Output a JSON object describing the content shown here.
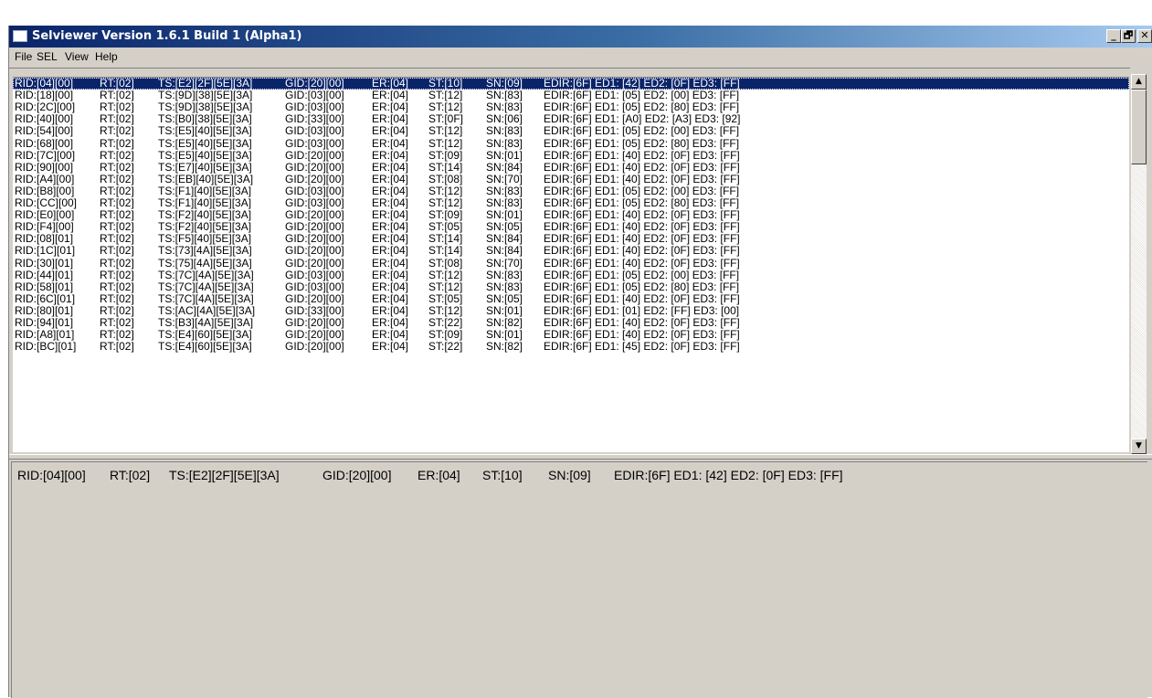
{
  "window": {
    "title": "Selviewer Version 1.6.1 Build 1 (Alpha1)",
    "controls": {
      "minimize": "_",
      "restore": "🗗",
      "close": "✕"
    }
  },
  "menu": [
    "File",
    "SEL",
    "View",
    "Help"
  ],
  "scrollbar": {
    "up": "▲",
    "down": "▼"
  },
  "columns": [
    "rid",
    "rt",
    "ts",
    "gid",
    "er",
    "st",
    "sn",
    "edir"
  ],
  "rows": [
    {
      "rid": "RID:[04][00]",
      "rt": "RT:[02]",
      "ts": "TS:[E2][2F][5E][3A]",
      "gid": "GID:[20][00]",
      "er": "ER:[04]",
      "st": "ST:[10]",
      "sn": "SN:[09]",
      "edir": "EDIR:[6F] ED1: [42] ED2: [0F] ED3: [FF]"
    },
    {
      "rid": "RID:[18][00]",
      "rt": "RT:[02]",
      "ts": "TS:[9D][38][5E][3A]",
      "gid": "GID:[03][00]",
      "er": "ER:[04]",
      "st": "ST:[12]",
      "sn": "SN:[83]",
      "edir": "EDIR:[6F] ED1: [05] ED2: [00] ED3: [FF]"
    },
    {
      "rid": "RID:[2C][00]",
      "rt": "RT:[02]",
      "ts": "TS:[9D][38][5E][3A]",
      "gid": "GID:[03][00]",
      "er": "ER:[04]",
      "st": "ST:[12]",
      "sn": "SN:[83]",
      "edir": "EDIR:[6F] ED1: [05] ED2: [80] ED3: [FF]"
    },
    {
      "rid": "RID:[40][00]",
      "rt": "RT:[02]",
      "ts": "TS:[B0][38][5E][3A]",
      "gid": "GID:[33][00]",
      "er": "ER:[04]",
      "st": "ST:[0F]",
      "sn": "SN:[06]",
      "edir": "EDIR:[6F] ED1: [A0] ED2: [A3] ED3: [92]"
    },
    {
      "rid": "RID:[54][00]",
      "rt": "RT:[02]",
      "ts": "TS:[E5][40][5E][3A]",
      "gid": "GID:[03][00]",
      "er": "ER:[04]",
      "st": "ST:[12]",
      "sn": "SN:[83]",
      "edir": "EDIR:[6F] ED1: [05] ED2: [00] ED3: [FF]"
    },
    {
      "rid": "RID:[68][00]",
      "rt": "RT:[02]",
      "ts": "TS:[E5][40][5E][3A]",
      "gid": "GID:[03][00]",
      "er": "ER:[04]",
      "st": "ST:[12]",
      "sn": "SN:[83]",
      "edir": "EDIR:[6F] ED1: [05] ED2: [80] ED3: [FF]"
    },
    {
      "rid": "RID:[7C][00]",
      "rt": "RT:[02]",
      "ts": "TS:[E5][40][5E][3A]",
      "gid": "GID:[20][00]",
      "er": "ER:[04]",
      "st": "ST:[09]",
      "sn": "SN:[01]",
      "edir": "EDIR:[6F] ED1: [40] ED2: [0F] ED3: [FF]"
    },
    {
      "rid": "RID:[90][00]",
      "rt": "RT:[02]",
      "ts": "TS:[E7][40][5E][3A]",
      "gid": "GID:[20][00]",
      "er": "ER:[04]",
      "st": "ST:[14]",
      "sn": "SN:[84]",
      "edir": "EDIR:[6F] ED1: [40] ED2: [0F] ED3: [FF]"
    },
    {
      "rid": "RID:[A4][00]",
      "rt": "RT:[02]",
      "ts": "TS:[EB][40][5E][3A]",
      "gid": "GID:[20][00]",
      "er": "ER:[04]",
      "st": "ST:[08]",
      "sn": "SN:[70]",
      "edir": "EDIR:[6F] ED1: [40] ED2: [0F] ED3: [FF]"
    },
    {
      "rid": "RID:[B8][00]",
      "rt": "RT:[02]",
      "ts": "TS:[F1][40][5E][3A]",
      "gid": "GID:[03][00]",
      "er": "ER:[04]",
      "st": "ST:[12]",
      "sn": "SN:[83]",
      "edir": "EDIR:[6F] ED1: [05] ED2: [00] ED3: [FF]"
    },
    {
      "rid": "RID:[CC][00]",
      "rt": "RT:[02]",
      "ts": "TS:[F1][40][5E][3A]",
      "gid": "GID:[03][00]",
      "er": "ER:[04]",
      "st": "ST:[12]",
      "sn": "SN:[83]",
      "edir": "EDIR:[6F] ED1: [05] ED2: [80] ED3: [FF]"
    },
    {
      "rid": "RID:[E0][00]",
      "rt": "RT:[02]",
      "ts": "TS:[F2][40][5E][3A]",
      "gid": "GID:[20][00]",
      "er": "ER:[04]",
      "st": "ST:[09]",
      "sn": "SN:[01]",
      "edir": "EDIR:[6F] ED1: [40] ED2: [0F] ED3: [FF]"
    },
    {
      "rid": "RID:[F4][00]",
      "rt": "RT:[02]",
      "ts": "TS:[F2][40][5E][3A]",
      "gid": "GID:[20][00]",
      "er": "ER:[04]",
      "st": "ST:[05]",
      "sn": "SN:[05]",
      "edir": "EDIR:[6F] ED1: [40] ED2: [0F] ED3: [FF]"
    },
    {
      "rid": "RID:[08][01]",
      "rt": "RT:[02]",
      "ts": "TS:[F5][40][5E][3A]",
      "gid": "GID:[20][00]",
      "er": "ER:[04]",
      "st": "ST:[14]",
      "sn": "SN:[84]",
      "edir": "EDIR:[6F] ED1: [40] ED2: [0F] ED3: [FF]"
    },
    {
      "rid": "RID:[1C][01]",
      "rt": "RT:[02]",
      "ts": "TS:[73][4A][5E][3A]",
      "gid": "GID:[20][00]",
      "er": "ER:[04]",
      "st": "ST:[14]",
      "sn": "SN:[84]",
      "edir": "EDIR:[6F] ED1: [40] ED2: [0F] ED3: [FF]"
    },
    {
      "rid": "RID:[30][01]",
      "rt": "RT:[02]",
      "ts": "TS:[75][4A][5E][3A]",
      "gid": "GID:[20][00]",
      "er": "ER:[04]",
      "st": "ST:[08]",
      "sn": "SN:[70]",
      "edir": "EDIR:[6F] ED1: [40] ED2: [0F] ED3: [FF]"
    },
    {
      "rid": "RID:[44][01]",
      "rt": "RT:[02]",
      "ts": "TS:[7C][4A][5E][3A]",
      "gid": "GID:[03][00]",
      "er": "ER:[04]",
      "st": "ST:[12]",
      "sn": "SN:[83]",
      "edir": "EDIR:[6F] ED1: [05] ED2: [00] ED3: [FF]"
    },
    {
      "rid": "RID:[58][01]",
      "rt": "RT:[02]",
      "ts": "TS:[7C][4A][5E][3A]",
      "gid": "GID:[03][00]",
      "er": "ER:[04]",
      "st": "ST:[12]",
      "sn": "SN:[83]",
      "edir": "EDIR:[6F] ED1: [05] ED2: [80] ED3: [FF]"
    },
    {
      "rid": "RID:[6C][01]",
      "rt": "RT:[02]",
      "ts": "TS:[7C][4A][5E][3A]",
      "gid": "GID:[20][00]",
      "er": "ER:[04]",
      "st": "ST:[05]",
      "sn": "SN:[05]",
      "edir": "EDIR:[6F] ED1: [40] ED2: [0F] ED3: [FF]"
    },
    {
      "rid": "RID:[80][01]",
      "rt": "RT:[02]",
      "ts": "TS:[AC][4A][5E][3A]",
      "gid": "GID:[33][00]",
      "er": "ER:[04]",
      "st": "ST:[12]",
      "sn": "SN:[01]",
      "edir": "EDIR:[6F] ED1: [01] ED2: [FF] ED3: [00]"
    },
    {
      "rid": "RID:[94][01]",
      "rt": "RT:[02]",
      "ts": "TS:[B3][4A][5E][3A]",
      "gid": "GID:[20][00]",
      "er": "ER:[04]",
      "st": "ST:[22]",
      "sn": "SN:[82]",
      "edir": "EDIR:[6F] ED1: [40] ED2: [0F] ED3: [FF]"
    },
    {
      "rid": "RID:[A8][01]",
      "rt": "RT:[02]",
      "ts": "TS:[E4][60][5E][3A]",
      "gid": "GID:[20][00]",
      "er": "ER:[04]",
      "st": "ST:[09]",
      "sn": "SN:[01]",
      "edir": "EDIR:[6F] ED1: [40] ED2: [0F] ED3: [FF]"
    },
    {
      "rid": "RID:[BC][01]",
      "rt": "RT:[02]",
      "ts": "TS:[E4][60][5E][3A]",
      "gid": "GID:[20][00]",
      "er": "ER:[04]",
      "st": "ST:[22]",
      "sn": "SN:[82]",
      "edir": "EDIR:[6F] ED1: [45] ED2: [0F] ED3: [FF]"
    }
  ],
  "detail": {
    "rid": "RID:[04][00]",
    "rt": "RT:[02]",
    "ts": "TS:[E2][2F][5E][3A]",
    "gid": "GID:[20][00]",
    "er": "ER:[04]",
    "st": "ST:[10]",
    "sn": "SN:[09]",
    "edir": "EDIR:[6F] ED1: [42] ED2: [0F] ED3: [FF]"
  }
}
